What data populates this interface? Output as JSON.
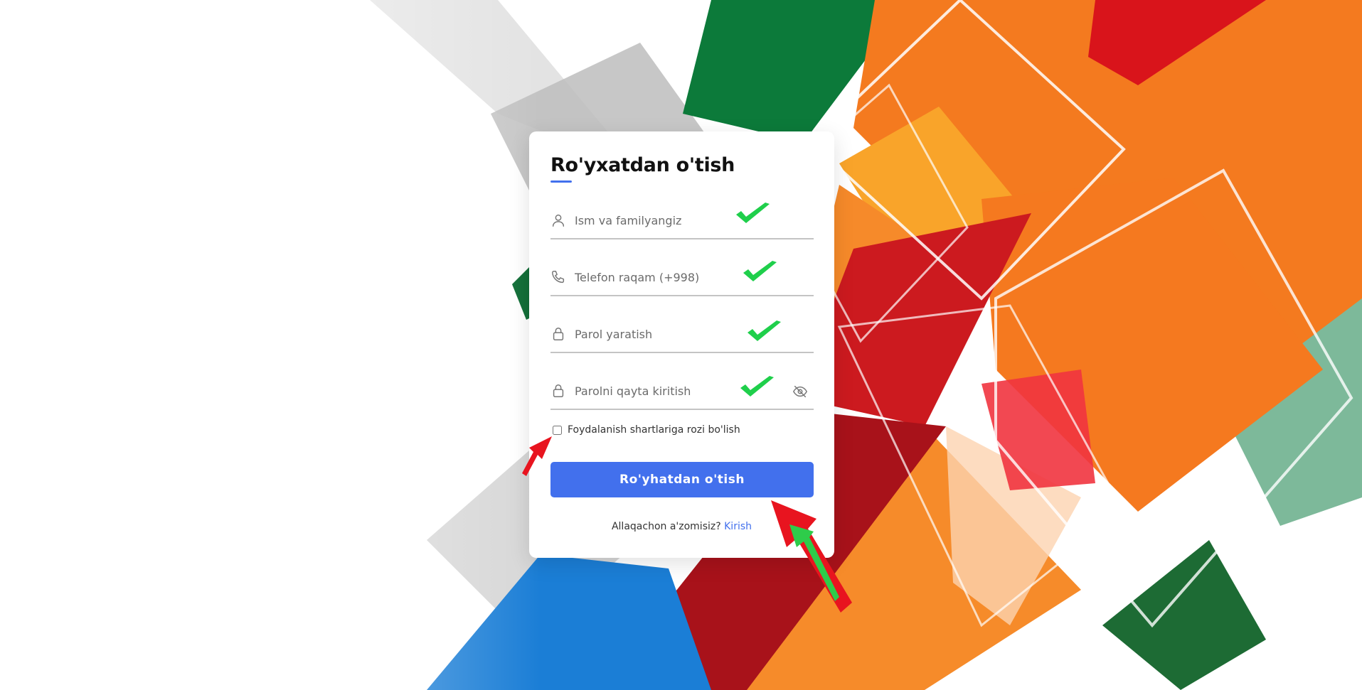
{
  "form": {
    "title": "Ro'yxatdan o'tish",
    "name_placeholder": "Ism va familyangiz",
    "phone_placeholder": "Telefon raqam (+998)",
    "password_placeholder": "Parol yaratish",
    "confirm_placeholder": "Parolni qayta kiritish",
    "terms_label": "Foydalanish shartlariga rozi bo'lish",
    "terms_checked": false,
    "submit_label": "Ro'yhatdan o'tish",
    "footer_text": "Allaqachon a'zomisiz?",
    "login_link": "Kirish"
  },
  "icons": {
    "name": "user-icon",
    "phone": "phone-icon",
    "password": "lock-icon",
    "confirm": "lock-icon",
    "toggle": "eye-off-icon",
    "valid": "check-icon",
    "arrow": "arrow-annotation-icon"
  },
  "colors": {
    "accent": "#4270ed",
    "check_green": "#1fcf4b",
    "annotation_red": "#e8141f",
    "field_border": "#c4c4c4"
  }
}
